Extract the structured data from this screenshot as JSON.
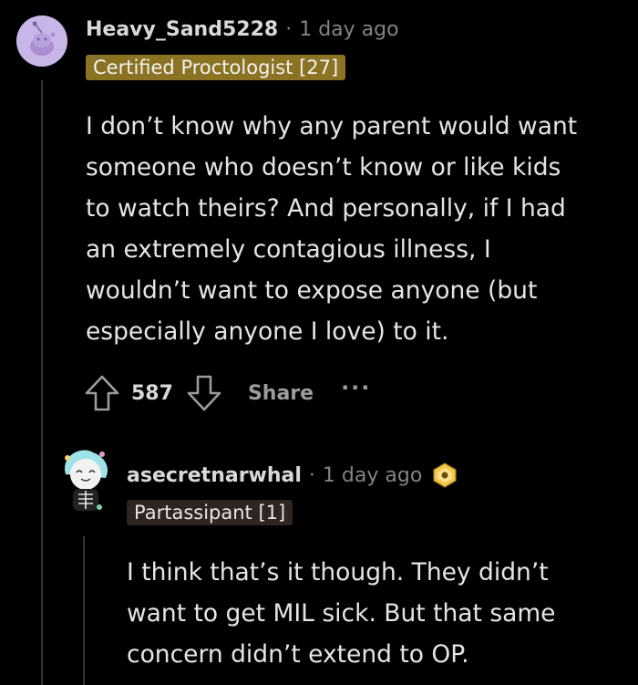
{
  "comment1": {
    "username": "Heavy_Sand5228",
    "separator": "·",
    "time": "1 day ago",
    "flair": "Certified Proctologist [27]",
    "lines": [
      "I don’t know why any parent would want",
      "someone who doesn’t know or like kids",
      "to watch theirs? And personally, if I had",
      "an extremely contagious illness, I",
      "wouldn’t want to expose anyone (but",
      "especially anyone I love) to it."
    ],
    "votes": "587",
    "share_label": "Share",
    "more_label": "···"
  },
  "comment2": {
    "username": "asecretnarwhal",
    "separator": "·",
    "time": "1 day ago",
    "flair": "Partassipant [1]",
    "lines": [
      "I think that’s it though. They didn’t",
      "want to get MIL sick. But that same",
      "concern didn’t extend to OP."
    ]
  },
  "colors": {
    "background": "#000000",
    "flair1_bg": "#8a7323",
    "flair2_bg": "#2e2523",
    "meta_gray": "#818384"
  }
}
